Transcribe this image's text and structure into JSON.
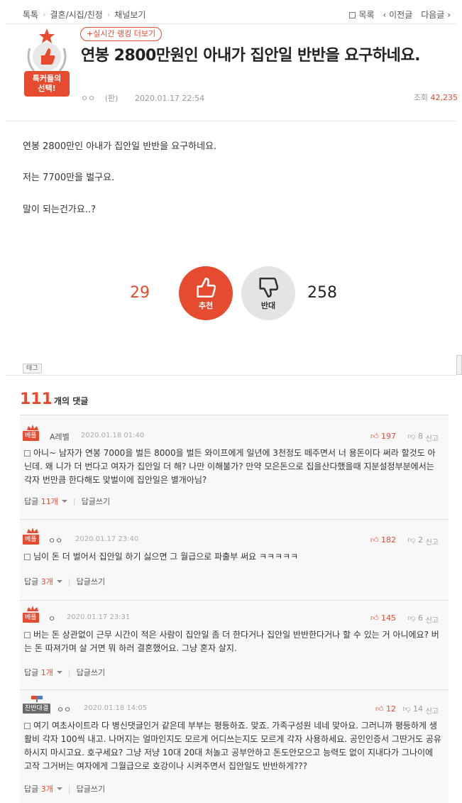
{
  "breadcrumb": [
    "톡톡",
    "결혼/시집/친정",
    "채널보기"
  ],
  "topnav": {
    "list": "목록",
    "prev": "이전글",
    "next": "다음글"
  },
  "badge": {
    "line1": "톡커들의",
    "line2": "선택!"
  },
  "rank_button": "+실시간 랭킹 더보기",
  "post": {
    "title": "연봉 2800만원인 아내가 집안일 반반을 요구하네요.",
    "author": "ㅇㅇ",
    "author_suffix": "(판)",
    "date": "2020.01.17 22:54",
    "views_label": "조회",
    "views": "42,235",
    "body": [
      "연봉 2800만인 아내가 집안일 반반을 요구하네요.",
      "저는 7700만을 벌구요.",
      "말이 되는건가요..?"
    ]
  },
  "vote": {
    "up_count": "29",
    "up_label": "추천",
    "down_label": "반대",
    "down_count": "258"
  },
  "tag_label": "태그",
  "comments_header": {
    "count": "111",
    "label": "개의 댓글"
  },
  "colors": {
    "accent": "#e64a2f"
  },
  "comments": [
    {
      "level": "베플",
      "name": "A레벨",
      "date": "2020.01.18 01:40",
      "likes": "197",
      "dislikes": "8",
      "text": "아니~ 남자가 연봉 7000을 벌든 8000을 벌든 와이프에게 일년에 3천정도 떼주면서 너 용돈이다 써라 할것도 아닌데. 왜 니가 더 번다고 여자가 집안일 더 해? 나만 이해불가? 만약 모은돈으로 집을산다했을때 지분설정부분에서는 각자 번만큼 한다해도 맞벌이에 집안일은 별개아님?",
      "reply_label": "답글",
      "reply_count": "11개",
      "write_label": "답글쓰기"
    },
    {
      "level": "베플",
      "name": "ㅇㅇ",
      "date": "2020.01.17 23:40",
      "likes": "182",
      "dislikes": "2",
      "text": "님이 돈 더 벌어서 집안일 하기 싫으면 그 월급으로 파출부 써요 ㅋㅋㅋㅋㅋ",
      "reply_label": "답글",
      "reply_count": "3개",
      "write_label": "답글쓰기"
    },
    {
      "level": "베플",
      "name": "ㅇ",
      "date": "2020.01.17 23:31",
      "likes": "145",
      "dislikes": "6",
      "text": "버는 돈 상관없이 근무 시간이 적은 사람이 집안일 좀 더 한다거나 집안일 반반한다거나 할 수 있는 거 아니에요? 버는 돈 따져가며 살 거면 뭐 하러 결혼했어요. 그냥 혼자 살지.",
      "reply_label": "답글",
      "reply_count": "1개",
      "write_label": "답글쓰기"
    },
    {
      "level": "찬반대결",
      "name": "ㅇㅇ",
      "date": "2020.01.18 14:05",
      "likes": "12",
      "dislikes": "14",
      "text": "여기 여초사이트라 다 병신댓글인거 같은데 부부는 평등하죠. 맞죠. 가족구성원 네네 맞아요. 그러니까 평등하게 생활비 각자 100씩 내고. 나머지는 얼마인지도 모르게 어디쓰는지도 모르게 각자 사용하세요. 공인인증서 그딴거도 공유하시지 마시고요. 호구세요? 그냥 저냥 10대 20대 처놀고 공부안하고 돈도안모으고 능력도 없이 지내다가 그나이에 고작 그거버는 여자에게 그월급으로 호강이나 시켜주면서 집안일도 반반하게???",
      "reply_label": "답글",
      "reply_count": "3개",
      "write_label": "답글쓰기"
    }
  ],
  "report_label": "신고"
}
